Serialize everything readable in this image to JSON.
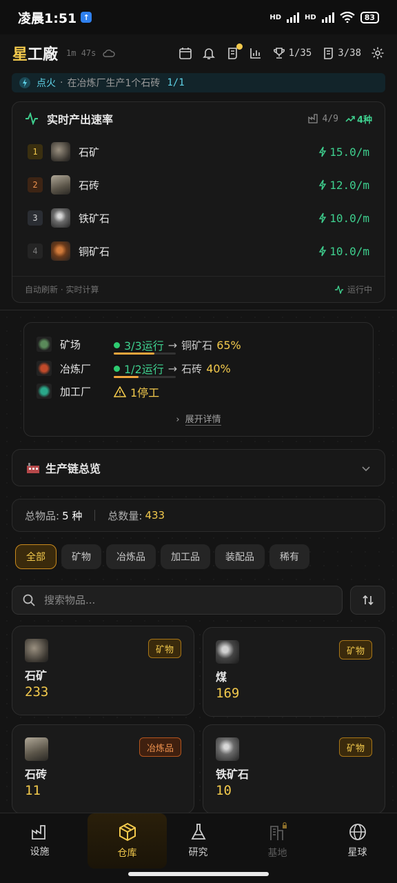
{
  "status_bar": {
    "time": "凌晨1:51",
    "battery": "83",
    "hd1": "HD",
    "hd2": "HD"
  },
  "header": {
    "logo_a": "星",
    "logo_b": "工廠",
    "timer": "1m 47s",
    "trophies": "1/35",
    "scrolls": "3/38"
  },
  "quest": {
    "label": "点火",
    "separator": "·",
    "desc": "在冶炼厂生产1个石砖",
    "progress": "1/1"
  },
  "rate_panel": {
    "title": "实时产出速率",
    "count": "4/9",
    "trend": "4种",
    "rows": [
      {
        "rank": "1",
        "name": "石矿",
        "rate": "15.0/m",
        "rank_color": "#f2c94c",
        "rank_bg": "#3a2f10"
      },
      {
        "rank": "2",
        "name": "石砖",
        "rate": "12.0/m",
        "rank_color": "#f0934f",
        "rank_bg": "#3d2414"
      },
      {
        "rank": "3",
        "name": "铁矿石",
        "rate": "10.0/m",
        "rank_color": "#cfcfcf",
        "rank_bg": "#2a2d33"
      },
      {
        "rank": "4",
        "name": "铜矿石",
        "rate": "10.0/m",
        "rank_color": "#7a7a7a",
        "rank_bg": "#242424"
      }
    ],
    "footer_left": "自动刷新 · 实时计算",
    "footer_right": "运行中"
  },
  "facilities": {
    "mine": {
      "name": "矿场",
      "status": "3/3运行",
      "arrow": "→",
      "product": "铜矿石",
      "percent": "65%",
      "progress": 0.65
    },
    "smelter": {
      "name": "冶炼厂",
      "status": "1/2运行",
      "arrow": "→",
      "product": "石砖",
      "percent": "40%",
      "progress": 0.4
    },
    "workshop": {
      "name": "加工厂",
      "status": "1停工"
    },
    "expand": "展开详情"
  },
  "chain": {
    "title": "生产链总览"
  },
  "totals": {
    "items_label": "总物品:",
    "items_value": "5 种",
    "qty_label": "总数量:",
    "qty_value": "433"
  },
  "filters": [
    "全部",
    "矿物",
    "冶炼品",
    "加工品",
    "装配品",
    "稀有"
  ],
  "search": {
    "placeholder": "搜索物品..."
  },
  "inventory": [
    {
      "name": "石矿",
      "count": "233",
      "tag": "矿物"
    },
    {
      "name": "煤",
      "count": "169",
      "tag": "矿物"
    },
    {
      "name": "石砖",
      "count": "11",
      "tag": "冶炼品"
    },
    {
      "name": "铁矿石",
      "count": "10",
      "tag": "矿物"
    }
  ],
  "nav": [
    "设施",
    "仓库",
    "研究",
    "基地",
    "星球"
  ],
  "colors": {
    "accent": "#f2c94c",
    "green": "#3ecf8e",
    "cyan": "#5fd3e8"
  }
}
